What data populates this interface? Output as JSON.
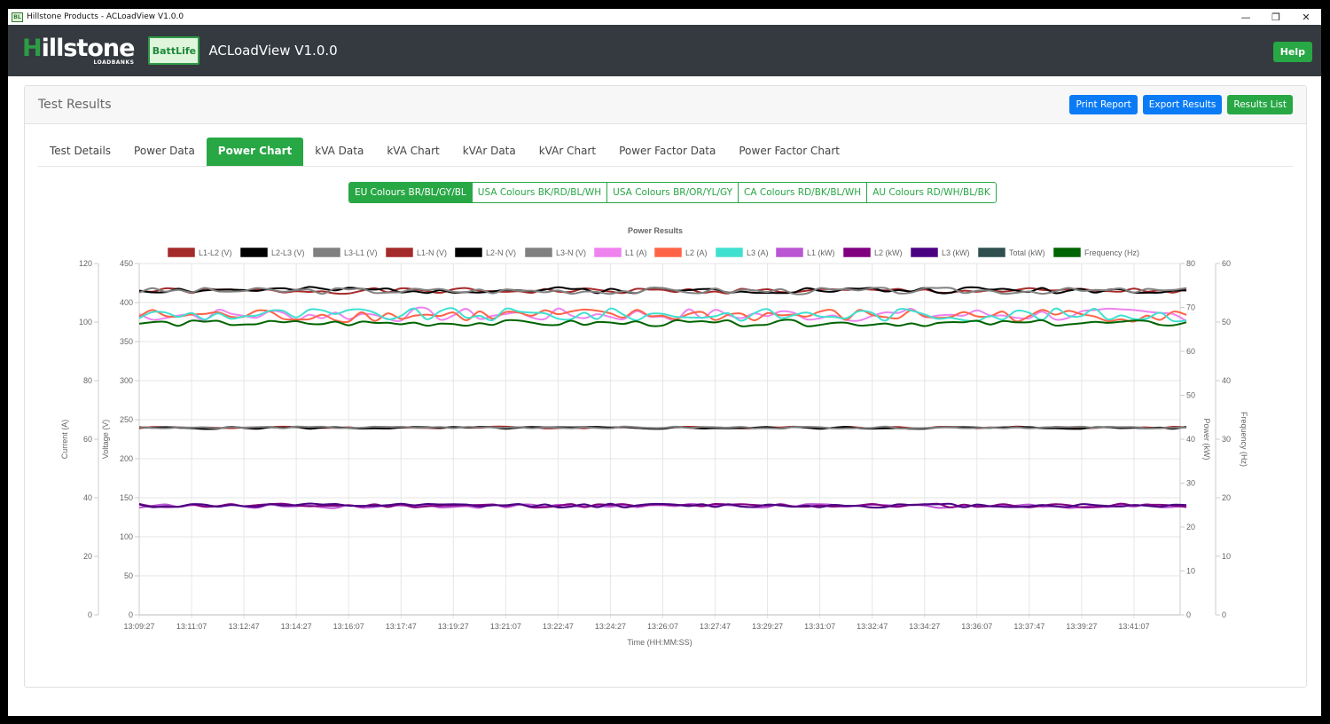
{
  "window": {
    "title": "Hillstone Products - ACLoadView V1.0.0",
    "app_icon_text": "BL",
    "controls": {
      "minimize": "—",
      "restore": "❐",
      "close": "✕"
    }
  },
  "appbar": {
    "logo_main": "illstone",
    "logo_initial": "H",
    "logo_sub": "LOADBANKS",
    "battlife": "BattLife",
    "title": "ACLoadView V1.0.0",
    "help_label": "Help"
  },
  "card": {
    "title": "Test Results",
    "buttons": {
      "print": "Print Report",
      "export": "Export Results",
      "list": "Results List"
    }
  },
  "tabs": [
    {
      "label": "Test Details",
      "active": false
    },
    {
      "label": "Power Data",
      "active": false
    },
    {
      "label": "Power Chart",
      "active": true
    },
    {
      "label": "kVA Data",
      "active": false
    },
    {
      "label": "kVA Chart",
      "active": false
    },
    {
      "label": "kVAr Data",
      "active": false
    },
    {
      "label": "kVAr Chart",
      "active": false
    },
    {
      "label": "Power Factor Data",
      "active": false
    },
    {
      "label": "Power Factor Chart",
      "active": false
    }
  ],
  "colour_schemes": [
    {
      "label": "EU Colours BR/BL/GY/BL",
      "active": true
    },
    {
      "label": "USA Colours BK/RD/BL/WH",
      "active": false
    },
    {
      "label": "USA Colours BR/OR/YL/GY",
      "active": false
    },
    {
      "label": "CA Colours RD/BK/BL/WH",
      "active": false
    },
    {
      "label": "AU Colours RD/WH/BL/BK",
      "active": false
    }
  ],
  "colors": {
    "accent_green": "#28a745",
    "accent_blue": "#0b7bf5",
    "appbar": "#343a40"
  },
  "chart_data": {
    "type": "line",
    "title": "Power Results",
    "xlabel": "Time (HH:MM:SS)",
    "x_ticks": [
      "13:09:27",
      "13:11:07",
      "13:12:47",
      "13:14:27",
      "13:16:07",
      "13:17:47",
      "13:19:27",
      "13:21:07",
      "13:22:47",
      "13:24:27",
      "13:26:07",
      "13:27:47",
      "13:29:27",
      "13:31:07",
      "13:32:47",
      "13:34:27",
      "13:36:07",
      "13:37:47",
      "13:39:27",
      "13:41:07"
    ],
    "x_start_seconds": 0,
    "x_tick_interval_seconds": 100,
    "x_end_seconds": 2005,
    "sample_interval_seconds": 25,
    "grid": true,
    "legend_position": "top",
    "axes": [
      {
        "id": "current",
        "label": "Current (A)",
        "side": "left-outer",
        "ylim": [
          0,
          120
        ],
        "ticks": [
          0,
          20,
          40,
          60,
          80,
          100,
          120
        ]
      },
      {
        "id": "voltage",
        "label": "Voltage (V)",
        "side": "left-inner",
        "ylim": [
          0,
          450
        ],
        "ticks": [
          0,
          50,
          100,
          150,
          200,
          250,
          300,
          350,
          400,
          450
        ]
      },
      {
        "id": "power",
        "label": "Power (kW)",
        "side": "right-inner",
        "ylim": [
          0,
          80
        ],
        "ticks": [
          0,
          10,
          20,
          30,
          40,
          50,
          60,
          70,
          80
        ]
      },
      {
        "id": "frequency",
        "label": "Frequency (Hz)",
        "side": "right-outer",
        "ylim": [
          0,
          60
        ],
        "ticks": [
          0,
          10,
          20,
          30,
          40,
          50,
          60
        ]
      }
    ],
    "series": [
      {
        "name": "L1-L2 (V)",
        "axis": "voltage",
        "color": "#a52a2a",
        "base": 415,
        "amp": 3.5,
        "seed": 1
      },
      {
        "name": "L2-L3 (V)",
        "axis": "voltage",
        "color": "#000000",
        "base": 416,
        "amp": 4.0,
        "seed": 2
      },
      {
        "name": "L3-L1 (V)",
        "axis": "voltage",
        "color": "#808080",
        "base": 415,
        "amp": 4.0,
        "seed": 3
      },
      {
        "name": "L1-N (V)",
        "axis": "voltage",
        "color": "#a52a2a",
        "base": 240,
        "amp": 1.2,
        "seed": 4
      },
      {
        "name": "L2-N (V)",
        "axis": "voltage",
        "color": "#000000",
        "base": 239.5,
        "amp": 1.5,
        "seed": 5
      },
      {
        "name": "L3-N (V)",
        "axis": "voltage",
        "color": "#808080",
        "base": 240,
        "amp": 1.2,
        "seed": 6
      },
      {
        "name": "L1 (A)",
        "axis": "current",
        "color": "#ee82ee",
        "base": 102.5,
        "amp": 2.2,
        "seed": 7
      },
      {
        "name": "L2 (A)",
        "axis": "current",
        "color": "#ff6347",
        "base": 102.3,
        "amp": 2.2,
        "seed": 8
      },
      {
        "name": "L3 (A)",
        "axis": "current",
        "color": "#40e0d0",
        "base": 102.5,
        "amp": 2.2,
        "seed": 9
      },
      {
        "name": "L1 (kW)",
        "axis": "power",
        "color": "#ba55d3",
        "base": 24.8,
        "amp": 0.45,
        "seed": 10
      },
      {
        "name": "L2 (kW)",
        "axis": "power",
        "color": "#800080",
        "base": 24.9,
        "amp": 0.45,
        "seed": 11
      },
      {
        "name": "L3 (kW)",
        "axis": "power",
        "color": "#4b0082",
        "base": 24.9,
        "amp": 0.45,
        "seed": 12
      },
      {
        "name": "Total (kW)",
        "axis": "power",
        "color": "#2f4f4f",
        "base": null,
        "amp": 0,
        "seed": 13
      },
      {
        "name": "Frequency (Hz)",
        "axis": "frequency",
        "color": "#006400",
        "base": 49.8,
        "amp": 0.5,
        "seed": 14
      }
    ]
  }
}
